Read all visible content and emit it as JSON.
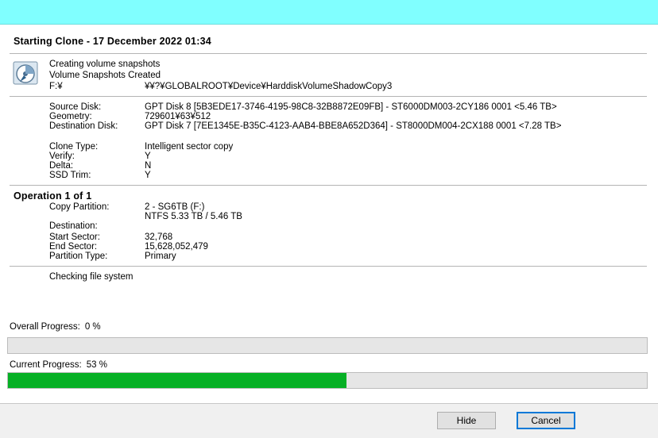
{
  "window": {
    "titlebar_color": "#80ffff"
  },
  "header": {
    "title": "Starting Clone - 17 December 2022  01:34"
  },
  "snapshot": {
    "icon": "volume-snapshot-icon",
    "line1": "Creating volume snapshots",
    "line2": "Volume Snapshots Created",
    "drive_label": "F:¥",
    "drive_value": "¥¥?¥GLOBALROOT¥Device¥HarddiskVolumeShadowCopy3"
  },
  "disks": {
    "source_label": "Source Disk:",
    "source_value": "GPT Disk 8 [5B3EDE17-3746-4195-98C8-32B8872E09FB] - ST6000DM003-2CY186 0001  <5.46 TB>",
    "geometry_label": "Geometry:",
    "geometry_value": "729601¥63¥512",
    "dest_label": "Destination Disk:",
    "dest_value": "GPT Disk 7 [7EE1345E-B35C-4123-AAB4-BBE8A652D364] - ST8000DM004-2CX188 0001  <7.28 TB>"
  },
  "options": {
    "clone_type_label": "Clone Type:",
    "clone_type_value": "Intelligent sector copy",
    "verify_label": "Verify:",
    "verify_value": "Y",
    "delta_label": "Delta:",
    "delta_value": "N",
    "ssd_trim_label": "SSD Trim:",
    "ssd_trim_value": "Y"
  },
  "operation": {
    "heading": "Operation 1 of 1",
    "copy_label": "Copy Partition:",
    "copy_value1": "2 - SG6TB (F:)",
    "copy_value2": "NTFS 5.33 TB / 5.46 TB",
    "destination_label": "Destination:",
    "start_label": "Start Sector:",
    "start_value": "32,768",
    "end_label": "End Sector:",
    "end_value": "15,628,052,479",
    "ptype_label": "Partition Type:",
    "ptype_value": "Primary"
  },
  "status": {
    "text": "Checking file system"
  },
  "progress": {
    "overall_label": "Overall Progress:",
    "overall_value": "0 %",
    "overall_fraction": 0.0,
    "current_label": "Current Progress:",
    "current_value": "53 %",
    "current_fraction": 0.53,
    "fill_color": "#06b025"
  },
  "buttons": {
    "hide": "Hide",
    "cancel": "Cancel"
  }
}
